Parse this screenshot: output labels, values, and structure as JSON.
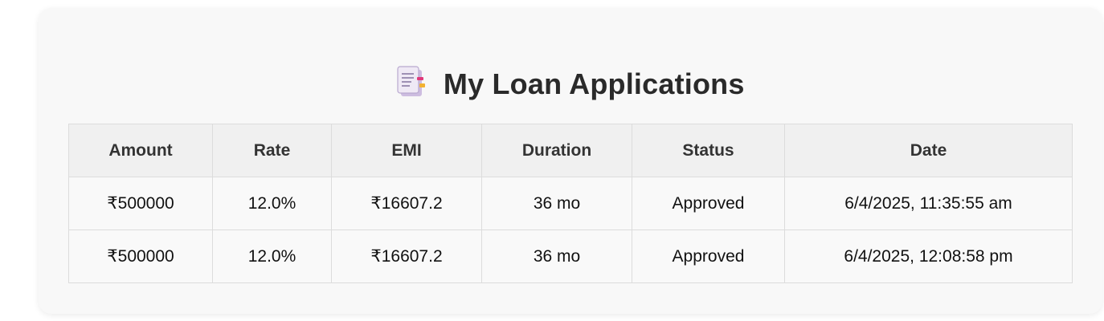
{
  "page": {
    "title": "My Loan Applications",
    "title_icon": "document-icon"
  },
  "table": {
    "headers": [
      "Amount",
      "Rate",
      "EMI",
      "Duration",
      "Status",
      "Date"
    ],
    "rows": [
      {
        "amount": "₹500000",
        "rate": "12.0%",
        "emi": "₹16607.2",
        "duration": "36 mo",
        "status": "Approved",
        "date": "6/4/2025, 11:35:55 am"
      },
      {
        "amount": "₹500000",
        "rate": "12.0%",
        "emi": "₹16607.2",
        "duration": "36 mo",
        "status": "Approved",
        "date": "6/4/2025, 12:08:58 pm"
      }
    ]
  },
  "colors": {
    "card_background": "#f8f8f8",
    "header_background": "#f0f0f0",
    "border": "#dcdcdc",
    "title_text": "#2a2a2a"
  }
}
